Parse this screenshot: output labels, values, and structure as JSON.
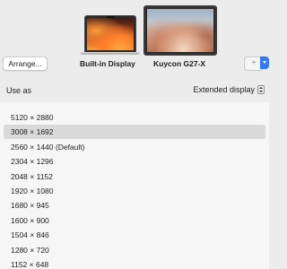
{
  "arrangement": {
    "arrange_button_label": "Arrange...",
    "displays": [
      {
        "label": "Built-in Display",
        "selected": false
      },
      {
        "label": "Kuycon G27-X",
        "selected": true
      }
    ],
    "add_button_label": "+"
  },
  "settings": {
    "use_as_label": "Use as",
    "use_as_value": "Extended display",
    "selected_index": 1,
    "resolutions": [
      "5120 × 2880",
      "3008 × 1692",
      "2560 × 1440 (Default)",
      "2304 × 1296",
      "2048 × 1152",
      "1920 × 1080",
      "1680 × 945",
      "1600 × 900",
      "1504 × 846",
      "1280 × 720",
      "1152 × 648"
    ]
  }
}
